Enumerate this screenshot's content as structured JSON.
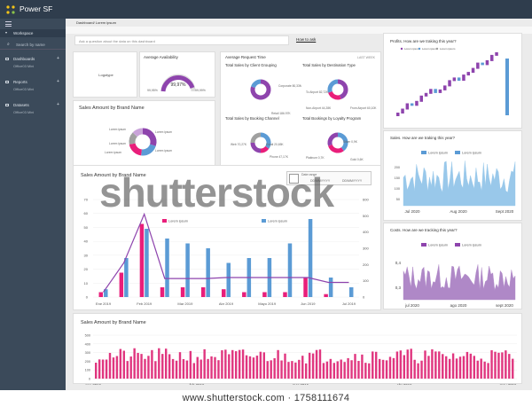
{
  "app": {
    "title": "Power SF",
    "breadcrumb": "Dashboard/ Lorem ipsum"
  },
  "sidebar": {
    "workspace": "Workspace",
    "search_placeholder": "Search by name",
    "items": [
      {
        "label": "Dashboards",
        "sub": "Office03 Mini"
      },
      {
        "label": "Reports",
        "sub": "Office03 Mini"
      },
      {
        "label": "Datasets",
        "sub": "Office03 Mini"
      }
    ]
  },
  "qa": {
    "placeholder": "Ask a question about the data on this dashboard",
    "link": "How to ask"
  },
  "logo_card": {
    "label": "Logotype"
  },
  "availability": {
    "title": "Average Availability",
    "value": "99,97%",
    "min": "99,95%",
    "max": "99,99%"
  },
  "request_time": {
    "title": "Average Request Time",
    "range": "LAST WEEK"
  },
  "minis": [
    {
      "title": "Total Sales by Client Grouping",
      "labels": [
        "Corporate 80,33M",
        "Retail 186,97K"
      ],
      "colors": [
        "#8e44ad",
        "#5b9bd5"
      ],
      "values": [
        80,
        20
      ]
    },
    {
      "title": "Total Sales by Destination Type",
      "labels": [
        "To Airport 82,72K",
        "Non-Airport 44,28K",
        "From Airport 60,10K"
      ],
      "colors": [
        "#8e44ad",
        "#e91e7a",
        "#5b9bd5"
      ],
      "values": [
        45,
        25,
        30
      ]
    },
    {
      "title": "Total Sales by Booking Channel",
      "labels": [
        "Web 70,27K",
        "Email 20,65K",
        "Phone 47,17K",
        "Walk up 67,41K"
      ],
      "colors": [
        "#5b9bd5",
        "#e91e7a",
        "#8e44ad",
        "#a0a0a0"
      ],
      "values": [
        35,
        15,
        25,
        25
      ]
    },
    {
      "title": "Total Bookings by Loyalty Program",
      "labels": [
        "Silver 0,9K",
        "Platinum 0,7K",
        "Gold 0,6K"
      ],
      "colors": [
        "#5b9bd5",
        "#e91e7a",
        "#8e44ad"
      ],
      "values": [
        40,
        30,
        30
      ]
    }
  ],
  "brand_small": {
    "title": "Sales Amount by Brand Name",
    "labels": [
      "Lorem ipsum",
      "Lorem ipsum",
      "Lorem ipsum",
      "Lorem ipsum",
      "Lorem ipsum"
    ],
    "colors": [
      "#8e44ad",
      "#5b9bd5",
      "#e91e7a",
      "#a0a0a0",
      "#c9a3d9"
    ],
    "values": [
      30,
      22,
      20,
      15,
      13
    ]
  },
  "brand_big": {
    "title": "Sales Amount by Brand Name",
    "date_range": "Date range",
    "date_from": "DD/MM/YYYY",
    "date_to": "DD/MM/YYYY"
  },
  "profits": {
    "title": "Profits. How are we traking this year?",
    "legend": [
      "Lorem ipsum",
      "Lorem ipsum",
      "Lorem ipsum"
    ]
  },
  "sales_track": {
    "title": "Sales. How are we traking this year?",
    "legend": [
      "Lorem ipsum",
      "Lorem ipsum"
    ],
    "xticks": [
      "Jul 2020",
      "Aug 2020",
      "Sept 2020"
    ]
  },
  "costs_track": {
    "title": "Costs. How are we tracking this year?",
    "legend": [
      "Lorem ipsum",
      "Lorem ipsum"
    ],
    "xticks": [
      "jul 2020",
      "ago 2020",
      "sept 2020"
    ],
    "yticks": [
      "0,4",
      "0,3"
    ]
  },
  "bottom": {
    "title": "Sales Amount by Brand Name",
    "xticks": [
      "ene 2016",
      "feb 2016",
      "mar 2016",
      "abr 2016",
      "may 2016"
    ]
  },
  "footer": "www.shutterstock.com · 1758111674",
  "watermark": "shutterstock",
  "chart_data": [
    {
      "type": "bar",
      "title": "Sales Amount by Brand Name",
      "categories": [
        "Ene 2019",
        "",
        "Feb 2019",
        "",
        "Mar 2019",
        "",
        "Abr 2019",
        "",
        "Mayo 2019",
        "",
        "Jun 2019",
        "",
        "Jul 2019"
      ],
      "series": [
        {
          "name": "Lorem ipsum",
          "color": "#e91e7a",
          "values": [
            5,
            25,
            75,
            10,
            10,
            10,
            8,
            5,
            5,
            5,
            20,
            3,
            0
          ]
        },
        {
          "name": "Lorem ipsum",
          "color": "#5b9bd5",
          "values": [
            8,
            40,
            70,
            60,
            55,
            50,
            35,
            40,
            40,
            55,
            80,
            20,
            10
          ]
        },
        {
          "name": "",
          "color": "#8e44ad",
          "values": [
            5,
            35,
            85,
            19,
            19,
            19,
            20,
            20,
            20,
            20,
            20,
            15,
            15
          ]
        }
      ],
      "yticks_left": [
        "0",
        "10",
        "20",
        "30",
        "40",
        "50",
        "60",
        "70"
      ],
      "yticks_right": [
        "0",
        "100",
        "200",
        "300",
        "400",
        "500",
        "600"
      ]
    },
    {
      "type": "area",
      "title": "Sales. How are we traking this year?",
      "yticks": [
        "200",
        "150",
        "100",
        "50"
      ]
    },
    {
      "type": "area",
      "title": "Costs. How are we tracking this year?"
    },
    {
      "type": "bar",
      "title": "Sales Amount by Brand Name",
      "yticks": [
        "500",
        "400",
        "300",
        "200",
        "100",
        "0"
      ]
    },
    {
      "type": "bar",
      "title": "Profits. How are we traking this year?"
    }
  ]
}
